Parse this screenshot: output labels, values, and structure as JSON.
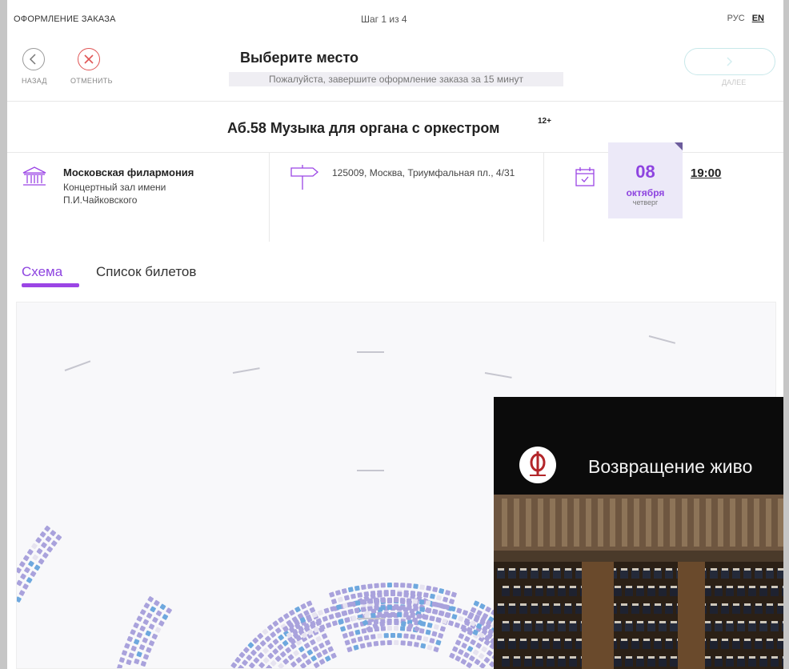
{
  "topbar": {
    "title": "ОФОРМЛЕНИЕ ЗАКАЗА",
    "step": "Шаг 1 из 4",
    "lang_ru": "РУС",
    "lang_en": "EN"
  },
  "nav": {
    "back_label": "НАЗАД",
    "cancel_label": "ОТМЕНИТЬ",
    "heading": "Выберите место",
    "notice": "Пожалуйста, завершите оформление заказа за 15 минут",
    "next_label": "ДАЛЕЕ"
  },
  "event": {
    "name": "Аб.58 Музыка для органа с оркестром",
    "age": "12+"
  },
  "venue": {
    "name": "Московская филармония",
    "hall": "Концертный зал имени П.И.Чайковского",
    "address": "125009, Москва, Триумфальная пл., 4/31"
  },
  "date": {
    "day": "08",
    "month": "октября",
    "weekday": "четверг",
    "time": "19:00"
  },
  "tabs": {
    "scheme": "Схема",
    "tickets": "Список билетов"
  },
  "video": {
    "title": "Возвращение живо"
  },
  "colors": {
    "accent": "#9b45e5",
    "seat": "#a9a2dc",
    "seat_blue": "#6ea8de",
    "cancel": "#e05555"
  }
}
